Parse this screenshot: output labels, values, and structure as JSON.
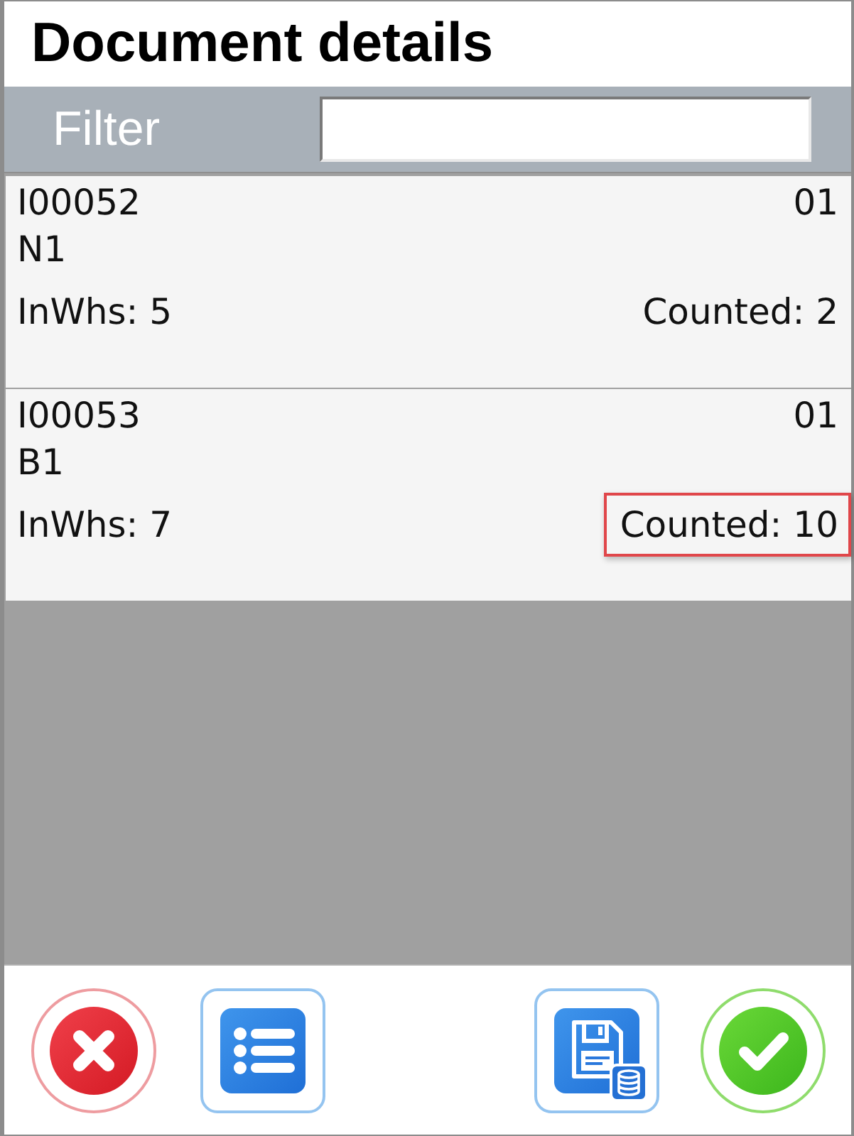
{
  "window": {
    "title": "Document details"
  },
  "filter": {
    "label": "Filter"
  },
  "items": [
    {
      "code": "I00052",
      "column_2": "01",
      "line_2": "N1",
      "in_whs": "InWhs: 5",
      "counted": "Counted: 2",
      "highlighted": false
    },
    {
      "code": "I00053",
      "column_2": "01",
      "line_2": "B1",
      "in_whs": "InWhs: 7",
      "counted": "Counted: 10",
      "highlighted": true
    }
  ],
  "toolbar": {
    "buttons": [
      {
        "kind": "cancel"
      },
      {
        "kind": "list"
      },
      {
        "kind": "save"
      },
      {
        "kind": "confirm"
      }
    ]
  }
}
